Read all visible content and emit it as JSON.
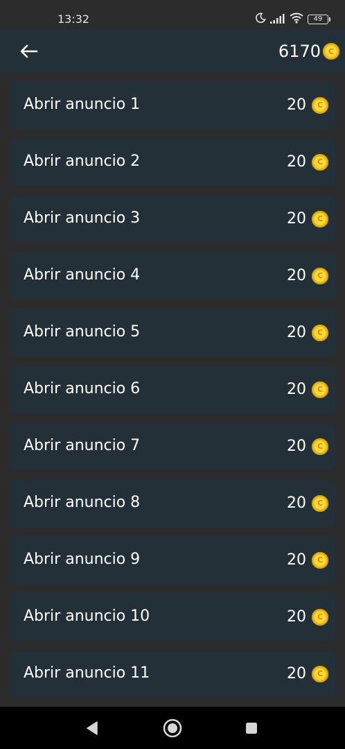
{
  "status_bar": {
    "time": "13:32",
    "battery": "49",
    "icons": [
      "moon-icon",
      "signal-icon",
      "wifi-icon",
      "battery-icon"
    ]
  },
  "header": {
    "back_icon": "arrow-left-icon",
    "balance": "6170",
    "coin_icon": "coin-icon",
    "coin_letter": "C"
  },
  "ads": [
    {
      "label": "Abrir anuncio 1",
      "reward": "20"
    },
    {
      "label": "Abrir anuncio 2",
      "reward": "20"
    },
    {
      "label": "Abrir anuncio 3",
      "reward": "20"
    },
    {
      "label": "Abrir anuncio 4",
      "reward": "20"
    },
    {
      "label": "Abrir anuncio 5",
      "reward": "20"
    },
    {
      "label": "Abrir anuncio 6",
      "reward": "20"
    },
    {
      "label": "Abrir anuncio 7",
      "reward": "20"
    },
    {
      "label": "Abrir anuncio 8",
      "reward": "20"
    },
    {
      "label": "Abrir anuncio 9",
      "reward": "20"
    },
    {
      "label": "Abrir anuncio 10",
      "reward": "20"
    },
    {
      "label": "Abrir anuncio 11",
      "reward": "20"
    }
  ],
  "nav_bar": {
    "icons": [
      "back-triangle-icon",
      "home-circle-icon",
      "recents-square-icon"
    ]
  },
  "colors": {
    "background": "#2c2c2c",
    "card": "#243037",
    "coin": "#f2c21b",
    "text": "#ffffff"
  }
}
